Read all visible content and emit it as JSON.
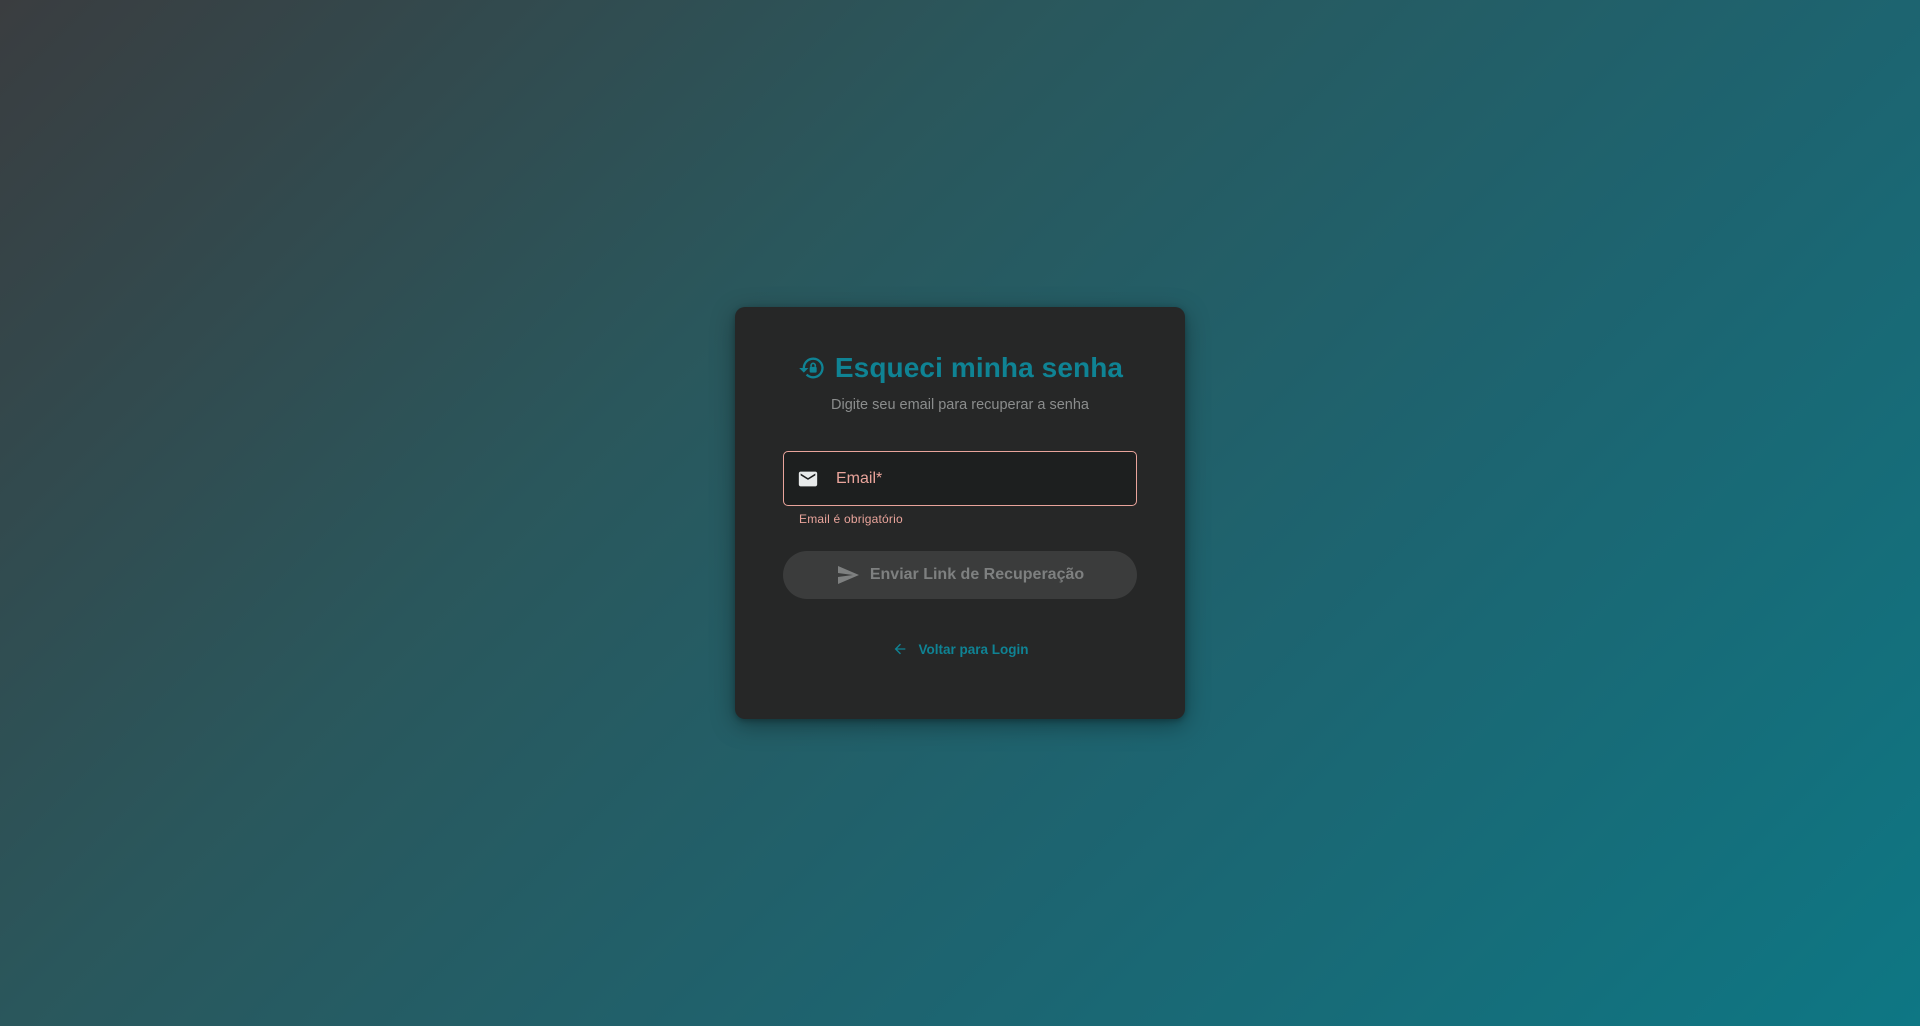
{
  "colors": {
    "accent": "#0f8394",
    "error": "#e9a49b",
    "card_background": "#262727",
    "muted_text": "#8b8d8d",
    "disabled_button": "#3b3c3c"
  },
  "card": {
    "title_icon": "lock-reset-icon",
    "title": "Esqueci minha senha",
    "subtitle": "Digite seu email para recuperar a senha"
  },
  "form": {
    "email": {
      "icon": "mail-icon",
      "placeholder": "Email*",
      "value": "",
      "error": "Email é obrigatório"
    },
    "submit": {
      "icon": "send-icon",
      "label": "Enviar Link de Recuperação",
      "disabled": "true"
    }
  },
  "back_link": {
    "icon": "arrow-left-icon",
    "label": "Voltar para Login"
  }
}
